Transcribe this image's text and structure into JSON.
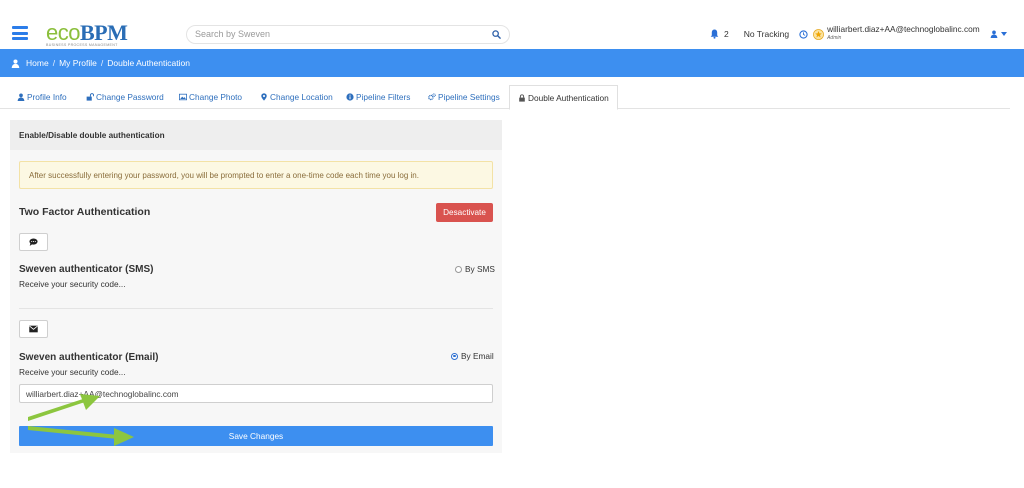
{
  "app": {
    "logo_eco": "eco",
    "logo_bpm": "BPM",
    "logo_tagline": "BUSINESS PROCESS MANAGEMENT"
  },
  "search": {
    "placeholder": "Search by Sweven",
    "icon": "search-icon"
  },
  "header": {
    "notification_count": "2",
    "tracking_label": "No Tracking",
    "user_email": "williarbert.diaz+AA@technoglobalinc.com",
    "user_role": "Admin"
  },
  "breadcrumb": {
    "items": [
      "Home",
      "My Profile",
      "Double Authentication"
    ],
    "separator": "/"
  },
  "tabs": [
    {
      "label": "Profile Info",
      "icon": "user-icon"
    },
    {
      "label": "Change Password",
      "icon": "unlock-icon"
    },
    {
      "label": "Change Photo",
      "icon": "photo-icon"
    },
    {
      "label": "Change Location",
      "icon": "map-marker-icon"
    },
    {
      "label": "Pipeline Filters",
      "icon": "info-icon"
    },
    {
      "label": "Pipeline Settings",
      "icon": "cogs-icon"
    },
    {
      "label": "Double Authentication",
      "icon": "lock-icon",
      "active": true
    }
  ],
  "panel": {
    "heading": "Enable/Disable double authentication",
    "alert_text": "After successfully entering your password, you will be prompted to enter a one-time code each time you log in.",
    "tfa_title": "Two Factor Authentication",
    "deactivate_label": "Desactivate",
    "sms": {
      "title": "Sweven authenticator (SMS)",
      "description": "Receive your security code...",
      "radio_label": "By SMS",
      "selected": false,
      "icon": "comment-icon"
    },
    "email": {
      "title": "Sweven authenticator (Email)",
      "description": "Receive your security code...",
      "radio_label": "By Email",
      "selected": true,
      "icon": "envelope-icon",
      "value": "williarbert.diaz+AA@technoglobalinc.com"
    },
    "save_label": "Save Changes"
  },
  "colors": {
    "primary": "#3d8ff0",
    "danger": "#d9534f",
    "alert_bg": "#fcf8e3",
    "annotation_arrow": "#8cc63f"
  }
}
